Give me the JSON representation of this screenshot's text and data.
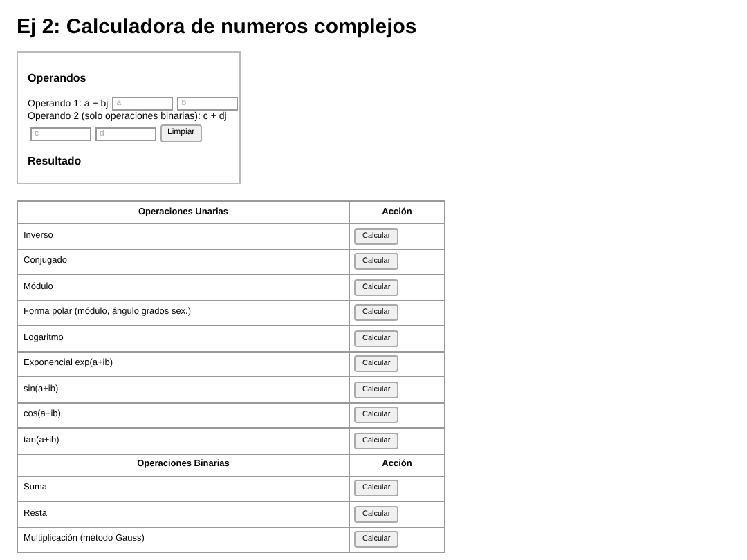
{
  "title": "Ej 2: Calculadora de numeros complejos",
  "operands": {
    "heading": "Operandos",
    "operand1": {
      "label": "Operando 1: a + bj",
      "fields": [
        {
          "placeholder": "a"
        },
        {
          "placeholder": "b"
        }
      ]
    },
    "operand2": {
      "label": "Operando 2 (solo operaciones binarias): c + dj",
      "fields": [
        {
          "placeholder": "c"
        },
        {
          "placeholder": "d"
        }
      ]
    },
    "clear_button": "Limpiar",
    "result_heading": "Resultado"
  },
  "sections": [
    {
      "header": "Operaciones Unarias",
      "action_header": "Acción",
      "rows": [
        {
          "name": "Inverso",
          "button": "Calcular"
        },
        {
          "name": "Conjugado",
          "button": "Calcular"
        },
        {
          "name": "Módulo",
          "button": "Calcular"
        },
        {
          "name": "Forma polar (módulo, ángulo grados sex.)",
          "button": "Calcular"
        },
        {
          "name": "Logaritmo",
          "button": "Calcular"
        },
        {
          "name": "Exponencial exp(a+ib)",
          "button": "Calcular"
        },
        {
          "name": "sin(a+ib)",
          "button": "Calcular"
        },
        {
          "name": "cos(a+ib)",
          "button": "Calcular"
        },
        {
          "name": "tan(a+ib)",
          "button": "Calcular"
        }
      ]
    },
    {
      "header": "Operaciones Binarias",
      "action_header": "Acción",
      "rows": [
        {
          "name": "Suma",
          "button": "Calcular"
        },
        {
          "name": "Resta",
          "button": "Calcular"
        },
        {
          "name": "Multiplicación (método Gauss)",
          "button": "Calcular"
        }
      ]
    }
  ]
}
